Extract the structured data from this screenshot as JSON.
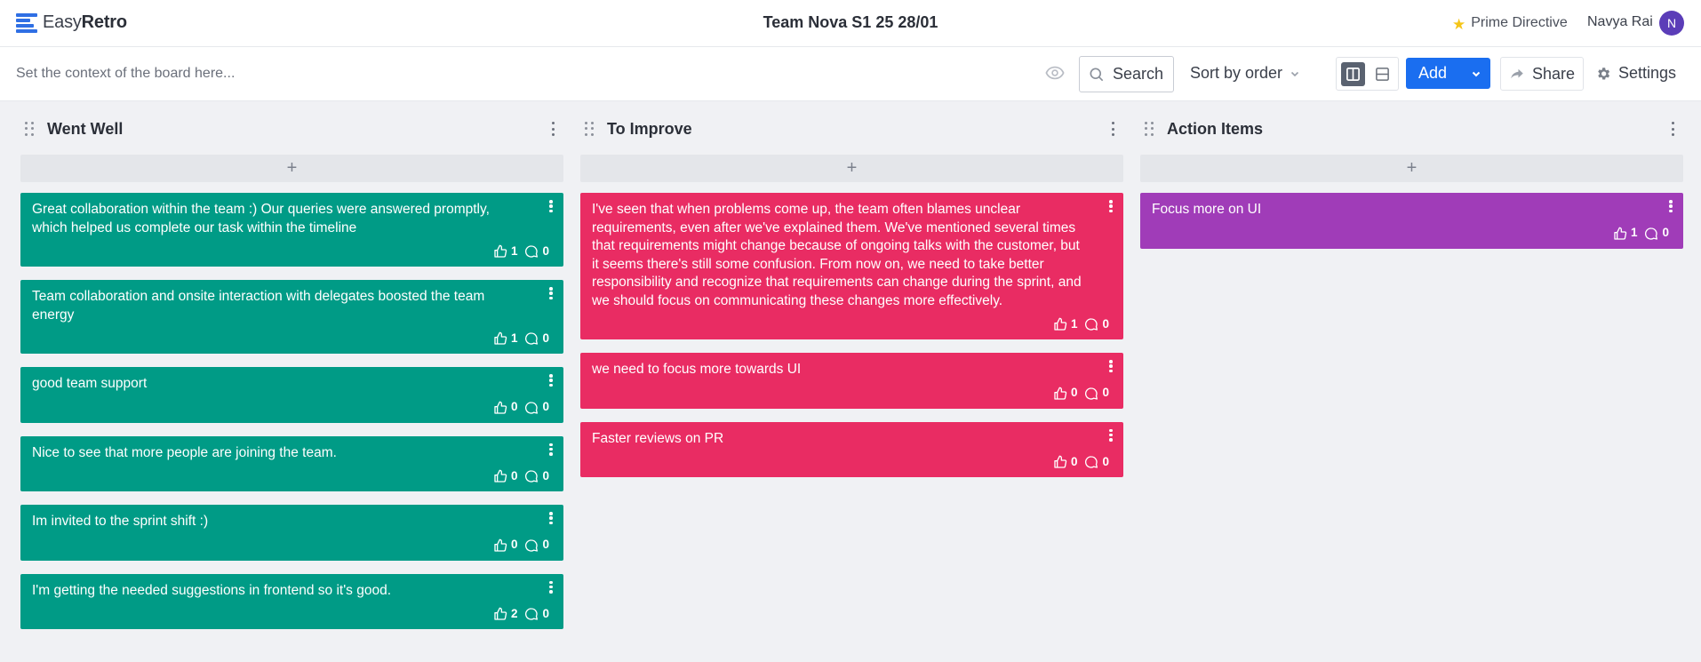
{
  "app": {
    "logo_light": "Easy",
    "logo_bold": "Retro"
  },
  "header": {
    "board_title": "Team Nova S1 25 28/01",
    "prime_directive": "Prime Directive",
    "user_name": "Navya Rai",
    "user_initial": "N"
  },
  "toolbar": {
    "context_placeholder": "Set the context of the board here...",
    "search_label": "Search",
    "sort_label": "Sort by order",
    "add_label": "Add",
    "share_label": "Share",
    "settings_label": "Settings"
  },
  "colors": {
    "went_well": "#009b86",
    "to_improve": "#e92c63",
    "action_items": "#a03cb8",
    "accent": "#1a6ef0"
  },
  "columns": [
    {
      "title": "Went Well",
      "add_symbol": "+",
      "cards": [
        {
          "text": "Great collaboration within the team :) Our queries were answered promptly, which helped us complete our task within the timeline",
          "likes": "1",
          "comments": "0"
        },
        {
          "text": "Team collaboration and onsite interaction with delegates boosted the team energy",
          "likes": "1",
          "comments": "0"
        },
        {
          "text": "good team support",
          "likes": "0",
          "comments": "0"
        },
        {
          "text": "Nice to see that more people are joining the team.",
          "likes": "0",
          "comments": "0"
        },
        {
          "text": "Im invited to the sprint shift :)",
          "likes": "0",
          "comments": "0"
        },
        {
          "text": "I'm getting the needed suggestions in frontend so it's good.",
          "likes": "2",
          "comments": "0"
        }
      ]
    },
    {
      "title": "To Improve",
      "add_symbol": "+",
      "cards": [
        {
          "text": "I've seen that when problems come up, the team often blames unclear requirements, even after we've explained them. We've mentioned several times that requirements might change because of ongoing talks with the customer, but it seems there's still some confusion. From now on, we need to take better responsibility and recognize that requirements can change during the sprint, and we should focus on communicating these changes more effectively.",
          "likes": "1",
          "comments": "0"
        },
        {
          "text": "we need to focus more towards UI",
          "likes": "0",
          "comments": "0"
        },
        {
          "text": "Faster reviews on PR",
          "likes": "0",
          "comments": "0"
        }
      ]
    },
    {
      "title": "Action Items",
      "add_symbol": "+",
      "cards": [
        {
          "text": "Focus more on UI",
          "likes": "1",
          "comments": "0"
        }
      ]
    }
  ]
}
